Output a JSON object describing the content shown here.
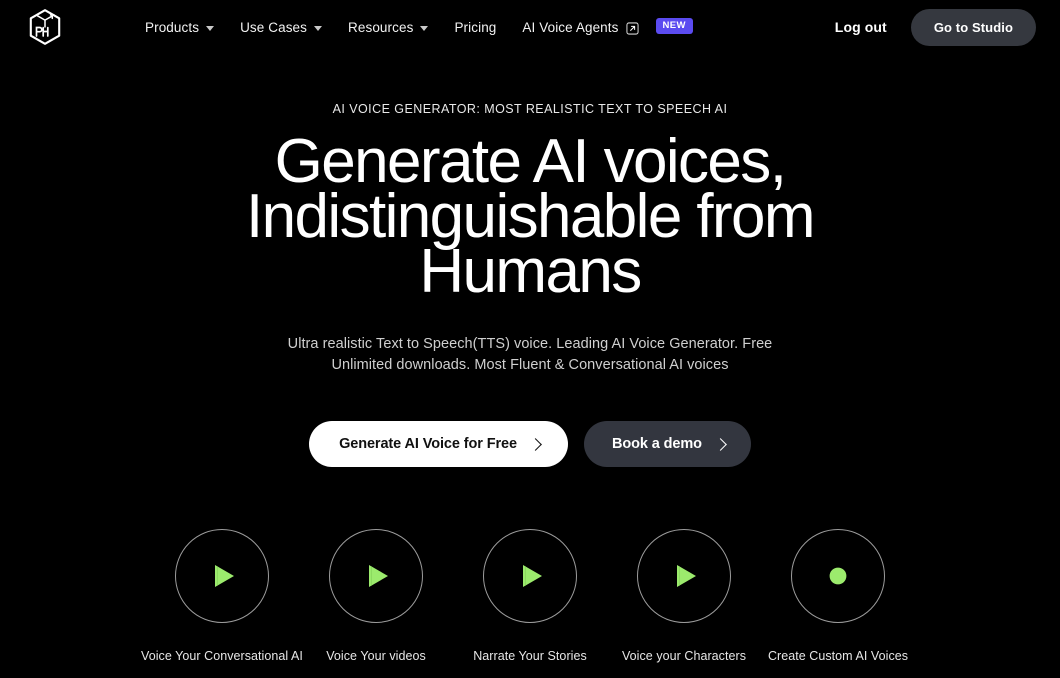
{
  "theme": {
    "background": "#000000",
    "accent_green": "#9ceb6d",
    "badge_purple": "#5b4bf0",
    "button_dark": "#33363f",
    "circle_stroke": "#9c9c9c"
  },
  "navbar": {
    "logo_name": "brand-logo",
    "links": [
      {
        "label": "Products",
        "has_dropdown": true,
        "external": false,
        "badge": null
      },
      {
        "label": "Use Cases",
        "has_dropdown": true,
        "external": false,
        "badge": null
      },
      {
        "label": "Resources",
        "has_dropdown": true,
        "external": false,
        "badge": null
      },
      {
        "label": "Pricing",
        "has_dropdown": false,
        "external": false,
        "badge": null
      },
      {
        "label": "AI Voice Agents",
        "has_dropdown": false,
        "external": true,
        "badge": "NEW"
      }
    ],
    "logout_label": "Log out",
    "studio_label": "Go to Studio"
  },
  "hero": {
    "eyebrow": "AI VOICE GENERATOR: MOST REALISTIC TEXT TO SPEECH AI",
    "headline": "Generate AI voices, Indistinguishable from Humans",
    "subhead": "Ultra realistic Text to Speech(TTS) voice. Leading AI Voice Generator. Free Unlimited downloads. Most Fluent & Conversational AI voices",
    "cta_primary": "Generate AI Voice for Free",
    "cta_secondary": "Book a demo"
  },
  "features": [
    {
      "label": "Voice Your Conversational AI",
      "icon": "play-icon"
    },
    {
      "label": "Voice Your videos",
      "icon": "play-icon"
    },
    {
      "label": "Narrate Your Stories",
      "icon": "play-icon"
    },
    {
      "label": "Voice your Characters",
      "icon": "play-icon"
    },
    {
      "label": "Create Custom AI Voices",
      "icon": "record-dot-icon"
    }
  ]
}
